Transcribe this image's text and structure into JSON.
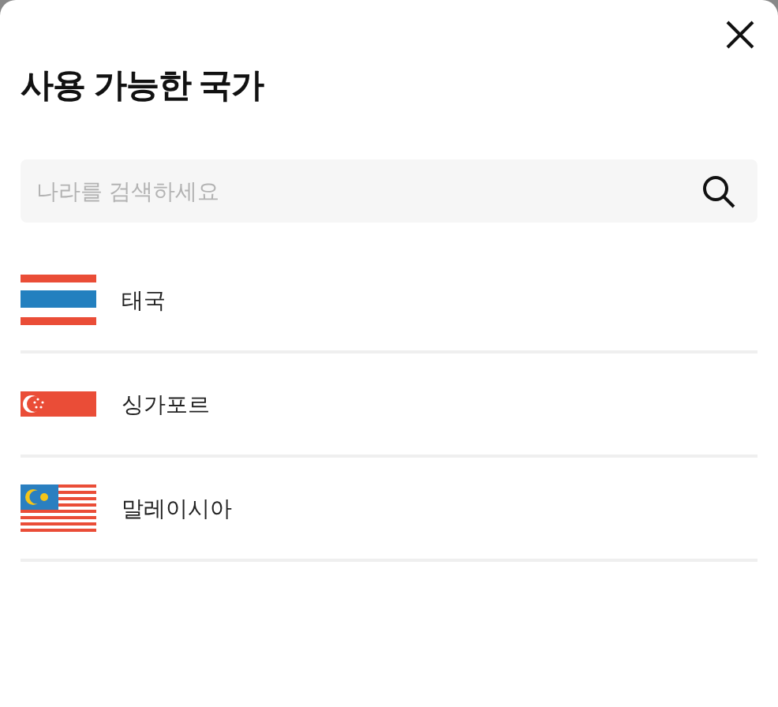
{
  "dialog": {
    "title": "사용 가능한 국가"
  },
  "search": {
    "placeholder": "나라를 검색하세요"
  },
  "countries": [
    {
      "name": "태국",
      "kind": "thailand"
    },
    {
      "name": "싱가포르",
      "kind": "singapore"
    },
    {
      "name": "말레이시아",
      "kind": "malaysia"
    }
  ]
}
